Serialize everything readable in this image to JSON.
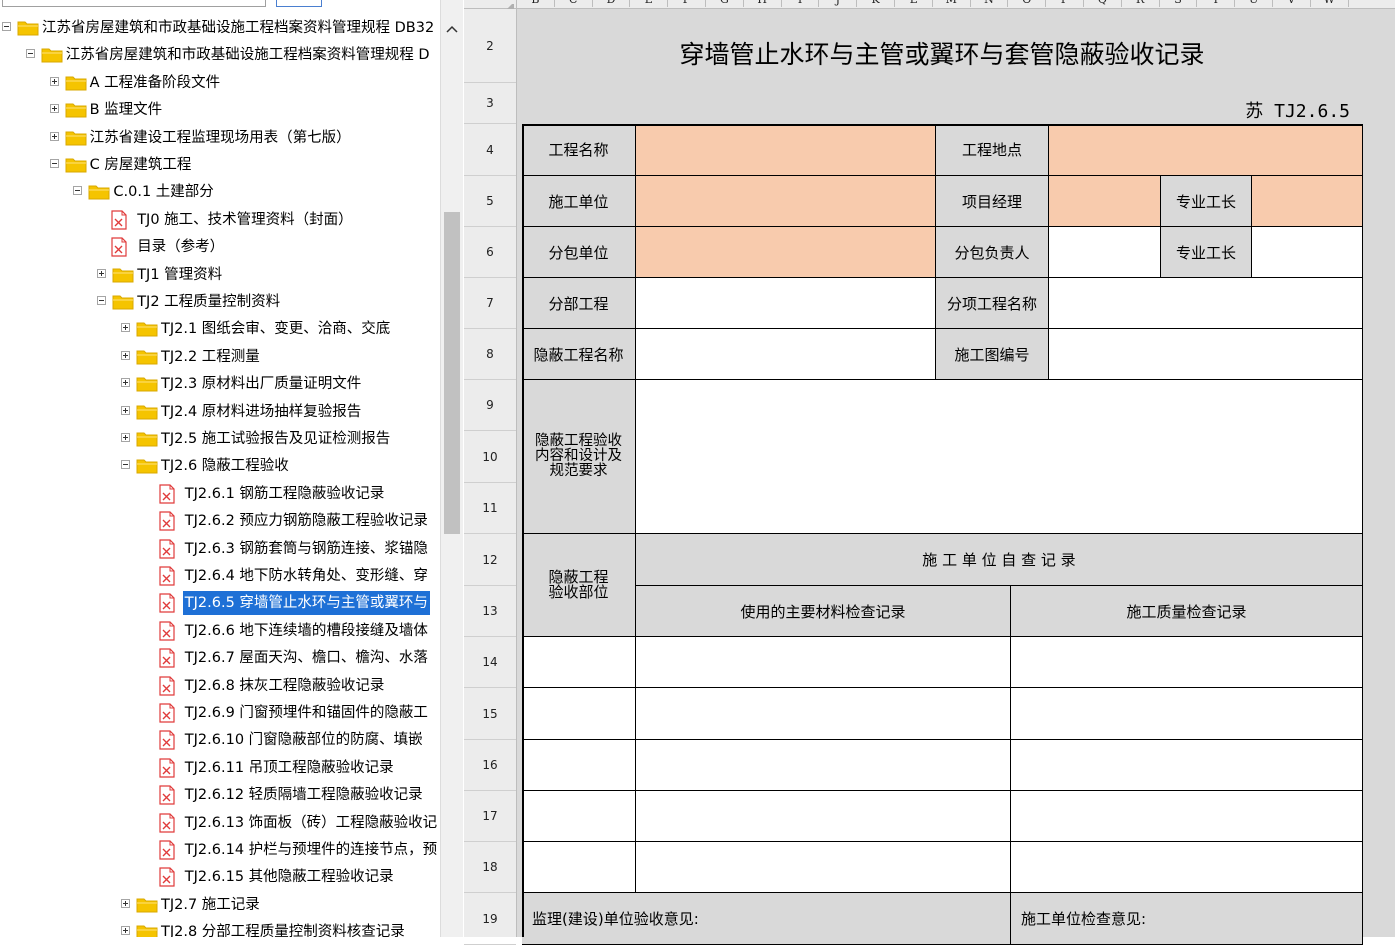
{
  "tree": {
    "nodes": [
      {
        "label": "江苏省房屋建筑和市政基础设施工程档案资料管理规程 DB32",
        "type": "folder",
        "toggle": "minus"
      },
      {
        "label": "江苏省房屋建筑和市政基础设施工程档案资料管理规程 D",
        "type": "folder",
        "toggle": "minus"
      },
      {
        "label": "A 工程准备阶段文件",
        "type": "folder",
        "toggle": "plus"
      },
      {
        "label": "B 监理文件",
        "type": "folder",
        "toggle": "plus"
      },
      {
        "label": "江苏省建设工程监理现场用表（第七版）",
        "type": "folder",
        "toggle": "plus"
      },
      {
        "label": "C 房屋建筑工程",
        "type": "folder",
        "toggle": "minus"
      },
      {
        "label": "C.0.1 土建部分",
        "type": "folder",
        "toggle": "minus"
      },
      {
        "label": "TJ0 施工、技术管理资料（封面）",
        "type": "doc"
      },
      {
        "label": "目录（参考）",
        "type": "doc"
      },
      {
        "label": "TJ1 管理资料",
        "type": "folder",
        "toggle": "plus"
      },
      {
        "label": "TJ2 工程质量控制资料",
        "type": "folder",
        "toggle": "minus"
      },
      {
        "label": "TJ2.1 图纸会审、变更、洽商、交底",
        "type": "folder",
        "toggle": "plus"
      },
      {
        "label": "TJ2.2 工程测量",
        "type": "folder",
        "toggle": "plus"
      },
      {
        "label": "TJ2.3 原材料出厂质量证明文件",
        "type": "folder",
        "toggle": "plus"
      },
      {
        "label": "TJ2.4 原材料进场抽样复验报告",
        "type": "folder",
        "toggle": "plus"
      },
      {
        "label": "TJ2.5 施工试验报告及见证检测报告",
        "type": "folder",
        "toggle": "plus"
      },
      {
        "label": "TJ2.6 隐蔽工程验收",
        "type": "folder",
        "toggle": "minus"
      },
      {
        "label": "TJ2.6.1 钢筋工程隐蔽验收记录",
        "type": "doc"
      },
      {
        "label": "TJ2.6.2 预应力钢筋隐蔽工程验收记录",
        "type": "doc"
      },
      {
        "label": "TJ2.6.3 钢筋套筒与钢筋连接、浆锚隐",
        "type": "doc"
      },
      {
        "label": "TJ2.6.4 地下防水转角处、变形缝、穿",
        "type": "doc"
      },
      {
        "label": "TJ2.6.5 穿墙管止水环与主管或翼环与",
        "type": "doc",
        "selected": true
      },
      {
        "label": "TJ2.6.6 地下连续墙的槽段接缝及墙体",
        "type": "doc"
      },
      {
        "label": "TJ2.6.7 屋面天沟、檐口、檐沟、水落",
        "type": "doc"
      },
      {
        "label": "TJ2.6.8 抹灰工程隐蔽验收记录",
        "type": "doc"
      },
      {
        "label": "TJ2.6.9 门窗预埋件和锚固件的隐蔽工",
        "type": "doc"
      },
      {
        "label": "TJ2.6.10 门窗隐蔽部位的防腐、填嵌",
        "type": "doc"
      },
      {
        "label": "TJ2.6.11 吊顶工程隐蔽验收记录",
        "type": "doc"
      },
      {
        "label": "TJ2.6.12 轻质隔墙工程隐蔽验收记录",
        "type": "doc"
      },
      {
        "label": "TJ2.6.13 饰面板（砖）工程隐蔽验收记",
        "type": "doc"
      },
      {
        "label": "TJ2.6.14 护栏与预埋件的连接节点，预",
        "type": "doc"
      },
      {
        "label": "TJ2.6.15 其他隐蔽工程验收记录",
        "type": "doc"
      },
      {
        "label": "TJ2.7 施工记录",
        "type": "folder",
        "toggle": "plus"
      },
      {
        "label": "TJ2.8 分部工程质量控制资料核查记录",
        "type": "folder",
        "toggle": "plus"
      }
    ]
  },
  "sheet": {
    "columns": [
      "B",
      "C",
      "D",
      "E",
      "F",
      "G",
      "H",
      "I",
      "J",
      "K",
      "L",
      "M",
      "N",
      "O",
      "P",
      "Q",
      "R",
      "S",
      "T",
      "U",
      "V",
      "W"
    ],
    "rows": [
      "2",
      "3",
      "4",
      "5",
      "6",
      "7",
      "8",
      "9",
      "10",
      "11",
      "12",
      "13",
      "14",
      "15",
      "16",
      "17",
      "18",
      "19"
    ]
  },
  "form": {
    "title": "穿墙管止水环与主管或翼环与套管隐蔽验收记录",
    "code": "苏 TJ2.6.5",
    "project_name_label": "工程名称",
    "project_location_label": "工程地点",
    "contractor_label": "施工单位",
    "project_manager_label": "项目经理",
    "foreman_label_1": "专业工长",
    "subcontractor_label": "分包单位",
    "sub_leader_label": "分包负责人",
    "foreman_label_2": "专业工长",
    "division_label": "分部工程",
    "subitem_label": "分项工程名称",
    "hidden_work_label": "隐蔽工程名称",
    "drawing_no_label": "施工图编号",
    "content_label": "隐蔽工程验收内容和设计及规范要求",
    "location_label": "隐蔽工程验收部位",
    "self_check_header": "施 工 单 位 自 查 记 录",
    "material_check_header": "使用的主要材料检查记录",
    "quality_check_header": "施工质量检查记录",
    "supervisor_opinion_label": "监理(建设)单位验收意见:",
    "contractor_opinion_label": "施工单位检查意见:"
  },
  "colors": {
    "selection": "#1e70d6",
    "label_cell": "#d9d9d9",
    "input_highlight": "#f8cbad",
    "folder": "#f5c400",
    "doc_icon": "#e03b3b"
  }
}
